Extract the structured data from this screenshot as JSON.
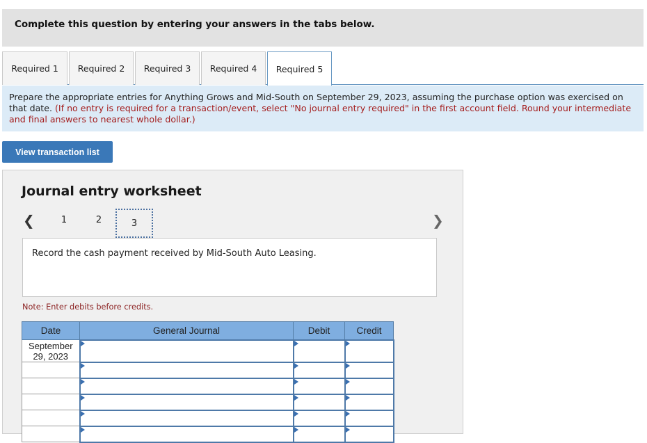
{
  "banner": {
    "text": "Complete this question by entering your answers in the tabs below."
  },
  "tabs": [
    {
      "label": "Required 1",
      "active": false
    },
    {
      "label": "Required 2",
      "active": false
    },
    {
      "label": "Required 3",
      "active": false
    },
    {
      "label": "Required 4",
      "active": false
    },
    {
      "label": "Required 5",
      "active": true
    }
  ],
  "instructions": {
    "main": "Prepare the appropriate entries for Anything Grows and Mid-South on September 29, 2023, assuming the purchase option was exercised on that date.",
    "note": "(If no entry is required for a transaction/event, select \"No journal entry required\" in the first account field. Round your intermediate and final answers to nearest whole dollar.)"
  },
  "view_transaction_button": "View transaction list",
  "worksheet": {
    "title": "Journal entry worksheet",
    "pager": {
      "prev_icon": "chevron-left-icon",
      "next_icon": "chevron-right-icon",
      "pages": [
        "1",
        "2",
        "3"
      ],
      "current": "3"
    },
    "prompt": "Record the cash payment received by Mid-South Auto Leasing.",
    "note": "Note: Enter debits before credits.",
    "table": {
      "headers": [
        "Date",
        "General Journal",
        "Debit",
        "Credit"
      ],
      "rows": [
        {
          "date": "September 29, 2023",
          "account": "",
          "debit": "",
          "credit": ""
        },
        {
          "date": "",
          "account": "",
          "debit": "",
          "credit": ""
        },
        {
          "date": "",
          "account": "",
          "debit": "",
          "credit": ""
        },
        {
          "date": "",
          "account": "",
          "debit": "",
          "credit": ""
        },
        {
          "date": "",
          "account": "",
          "debit": "",
          "credit": ""
        },
        {
          "date": "",
          "account": "",
          "debit": "",
          "credit": ""
        }
      ]
    }
  }
}
